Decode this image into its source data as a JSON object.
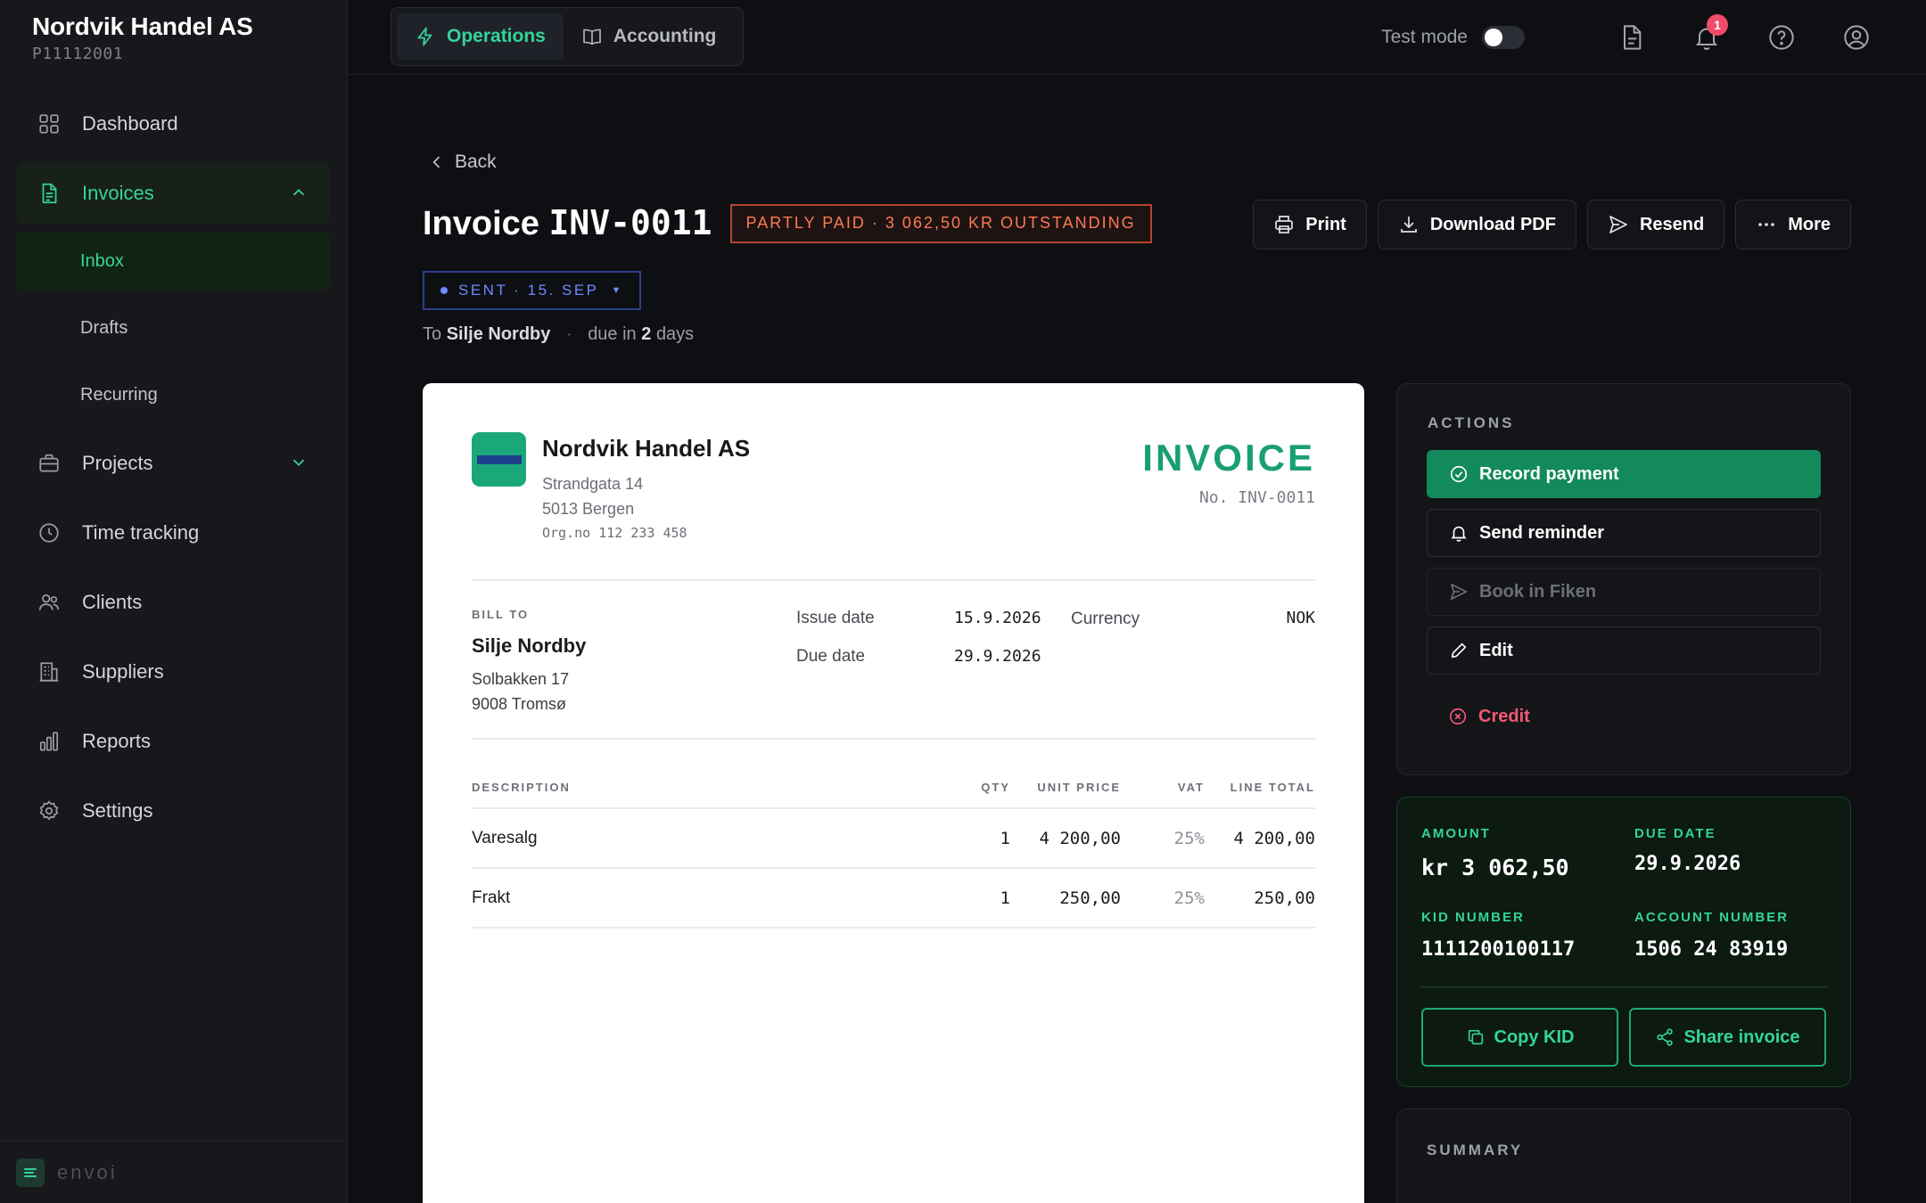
{
  "company": {
    "name": "Nordvik Handel AS",
    "id": "P11112001"
  },
  "sidebar": {
    "items": [
      {
        "label": "Dashboard",
        "icon": "grid-icon"
      },
      {
        "label": "Invoices",
        "icon": "document-icon",
        "expanded": true,
        "sub": [
          {
            "label": "Inbox",
            "active": true
          },
          {
            "label": "Drafts"
          },
          {
            "label": "Recurring"
          }
        ]
      },
      {
        "label": "Projects",
        "icon": "briefcase-icon",
        "expanded": false
      },
      {
        "label": "Time tracking",
        "icon": "clock-icon"
      },
      {
        "label": "Clients",
        "icon": "users-icon"
      },
      {
        "label": "Suppliers",
        "icon": "building-icon"
      },
      {
        "label": "Reports",
        "icon": "bar-chart-icon"
      },
      {
        "label": "Settings",
        "icon": "gear-icon"
      }
    ],
    "footer": {
      "brand": "envoi"
    }
  },
  "topbar": {
    "modes": [
      {
        "label": "Operations",
        "active": true,
        "icon": "bolt-icon"
      },
      {
        "label": "Accounting",
        "icon": "book-icon"
      }
    ],
    "test_mode_label": "Test mode",
    "test_mode_on": false,
    "notification_count": "1"
  },
  "header": {
    "back_label": "Back",
    "title_prefix": "Invoice",
    "invoice_number": "INV-0011",
    "status_chip": "PARTLY PAID · 3 062,50 KR OUTSTANDING",
    "sent_chip": "SENT · 15. SEP",
    "to_prefix": "To",
    "recipient": "Silje Nordby",
    "due_prefix": "due in",
    "due_days": "2",
    "due_suffix": "days",
    "actions": {
      "print": "Print",
      "download": "Download PDF",
      "resend": "Resend",
      "more": "More"
    }
  },
  "invoice": {
    "seller": {
      "name": "Nordvik Handel AS",
      "street": "Strandgata 14",
      "city": "5013 Bergen",
      "org": "Org.no 112 233 458"
    },
    "doc_word": "INVOICE",
    "doc_no": "No. INV-0011",
    "bill_to_label": "BILL TO",
    "buyer": {
      "name": "Silje Nordby",
      "street": "Solbakken 17",
      "city": "9008 Tromsø"
    },
    "issue_date_label": "Issue date",
    "issue_date": "15.9.2026",
    "due_date_label": "Due date",
    "due_date": "29.9.2026",
    "currency_label": "Currency",
    "currency": "NOK",
    "columns": {
      "desc": "DESCRIPTION",
      "qty": "QTY",
      "unit": "UNIT PRICE",
      "vat": "VAT",
      "total": "LINE TOTAL"
    },
    "lines": [
      {
        "desc": "Varesalg",
        "qty": "1",
        "unit": "4 200,00",
        "vat": "25%",
        "total": "4 200,00"
      },
      {
        "desc": "Frakt",
        "qty": "1",
        "unit": "250,00",
        "vat": "25%",
        "total": "250,00"
      }
    ]
  },
  "actions_panel": {
    "title": "ACTIONS",
    "record_payment": "Record payment",
    "send_reminder": "Send reminder",
    "book": "Book in Fiken",
    "edit": "Edit",
    "credit": "Credit"
  },
  "payment": {
    "amount_label": "AMOUNT",
    "amount": "kr 3 062,50",
    "due_label": "DUE DATE",
    "due": "29.9.2026",
    "kid_label": "KID NUMBER",
    "kid": "1111200100117",
    "account_label": "ACCOUNT NUMBER",
    "account": "1506 24 83919",
    "copy_kid": "Copy KID",
    "share": "Share invoice"
  },
  "summary": {
    "title": "SUMMARY"
  },
  "colors": {
    "accent": "#34d49a",
    "primary_button": "#128a5c",
    "status_orange": "#ff7a52",
    "sent_blue": "#6a8cff",
    "danger": "#f05a74"
  }
}
